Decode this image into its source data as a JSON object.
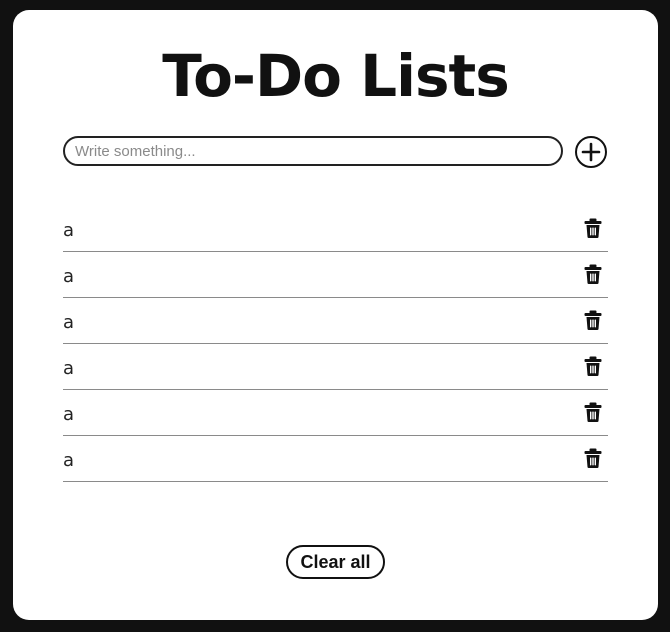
{
  "app": {
    "title": "To-Do Lists"
  },
  "input": {
    "placeholder": "Write something...",
    "value": ""
  },
  "add_button": {
    "icon": "plus-circle-icon"
  },
  "todos": [
    {
      "text": "a",
      "delete_icon": "trash-icon"
    },
    {
      "text": "a",
      "delete_icon": "trash-icon"
    },
    {
      "text": "a",
      "delete_icon": "trash-icon"
    },
    {
      "text": "a",
      "delete_icon": "trash-icon"
    },
    {
      "text": "a",
      "delete_icon": "trash-icon"
    },
    {
      "text": "a",
      "delete_icon": "trash-icon"
    }
  ],
  "clear_button": {
    "label": "Clear all"
  },
  "colors": {
    "background": "#111111",
    "card": "#ffffff",
    "text": "#111111",
    "divider": "#8a8a8a"
  }
}
